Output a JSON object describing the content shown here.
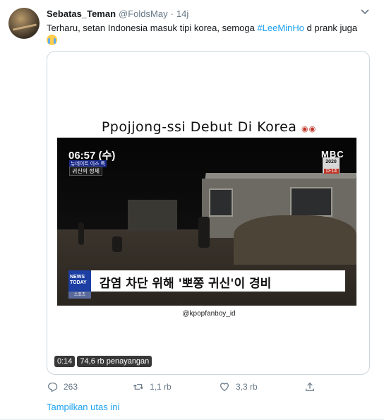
{
  "tweet": {
    "display_name": "Sebatas_Teman",
    "handle": "@FoldsMay",
    "separator": "·",
    "time": "14j",
    "text_before": "Terharu, setan Indonesia masuk tipi korea, semoga ",
    "hashtag": "#LeeMinHo",
    "text_after": " d prank juga",
    "emoji": "loudly-crying-face"
  },
  "media": {
    "video_title": "Ppojjong-ssi Debut Di Korea",
    "video_title_emoji": "eyes",
    "clock": "06:57 (수)",
    "news_tag_1": "뉴데이트 이스 특",
    "news_tag_2": "귀신의 정체",
    "channel": "MBC",
    "year_badge": "2020",
    "dday_badge": "D-14",
    "logo_text": "NEWS TODAY",
    "logo_sub": "스포츠",
    "headline": "감염 차단 위해 '뽀쫑 귀신'이 경비",
    "credit": "@kpopfanboy_id",
    "duration": "0:14",
    "views": "74,6 rb penayangan"
  },
  "actions": {
    "reply_count": "263",
    "retweet_count": "1,1 rb",
    "like_count": "3,3 rb"
  },
  "thread_link": "Tampilkan utas ini",
  "colors": {
    "accent": "#1da1f2",
    "secondary_text": "#657786",
    "border": "#ccd6dd"
  }
}
